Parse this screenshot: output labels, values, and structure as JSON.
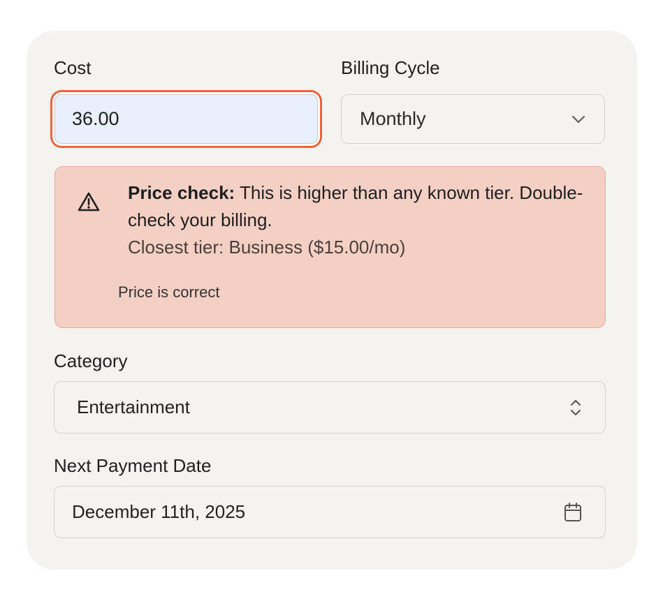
{
  "form": {
    "cost": {
      "label": "Cost",
      "value": "36.00"
    },
    "billing_cycle": {
      "label": "Billing Cycle",
      "selected": "Monthly"
    },
    "price_warning": {
      "title": "Price check:",
      "message": " This is higher than any known tier. Double-check your billing.",
      "closest_tier": "Closest tier: Business ($15.00/mo)",
      "confirm_link": "Price is correct"
    },
    "category": {
      "label": "Category",
      "selected": "Entertainment"
    },
    "next_payment_date": {
      "label": "Next Payment Date",
      "value": "December 11th, 2025"
    }
  },
  "colors": {
    "focus_ring": "#f2613a",
    "input_focus_bg": "#e8effd",
    "warning_bg": "#f4cfc4",
    "card_bg": "#f5f3ef"
  }
}
